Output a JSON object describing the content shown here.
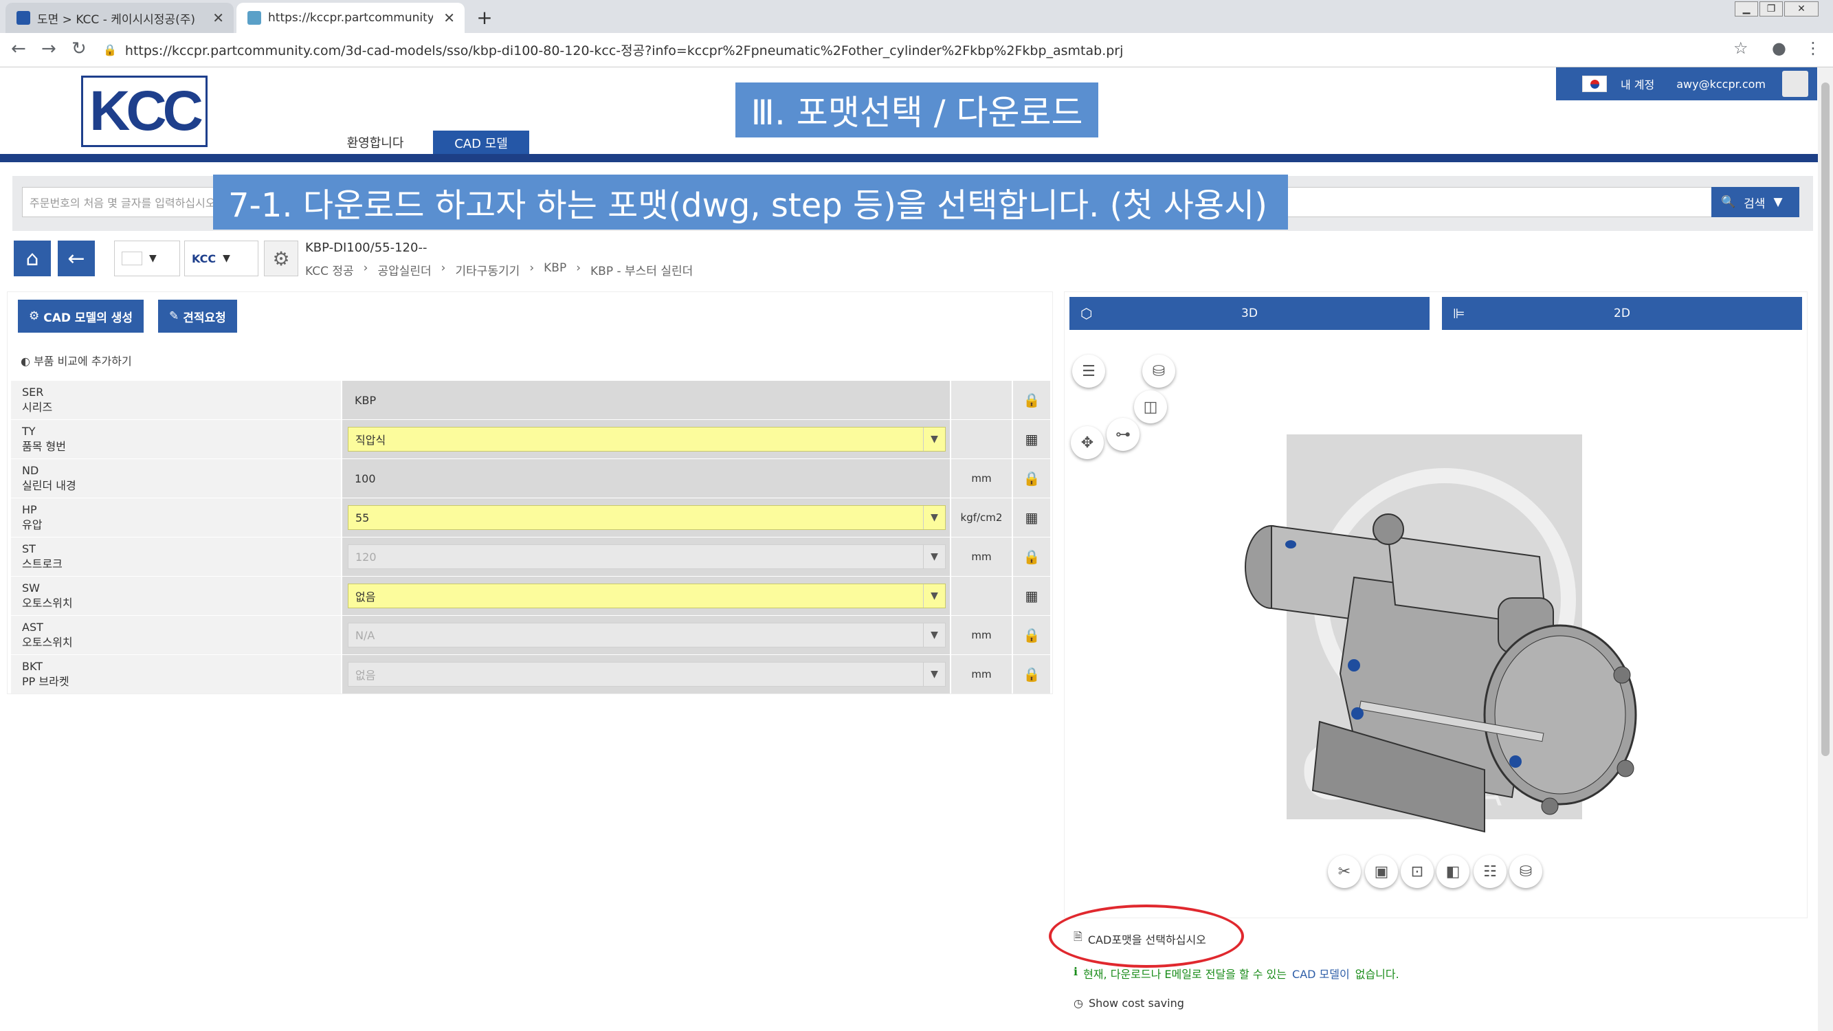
{
  "browser": {
    "tabs": [
      {
        "label": "도면 > KCC - 케이시시정공(주)",
        "active": false
      },
      {
        "label": "https://kccpr.partcommunity.cor",
        "active": true
      }
    ],
    "url": "https://kccpr.partcommunity.com/3d-cad-models/sso/kbp-di100-80-120-kcc-정공?info=kccpr%2Fpneumatic%2Fother_cylinder%2Fkbp%2Fkbp_asmtab.prj"
  },
  "header": {
    "logo": "KCC",
    "nav": {
      "welcome": "환영합니다",
      "cad": "CAD 모델"
    },
    "account": {
      "label": "내 계정",
      "email": "awy@kccpr.com"
    }
  },
  "overlays": {
    "title": "Ⅲ. 포맷선택 / 다운로드",
    "step": "7-1. 다운로드 하고자 하는 포맷(dwg, step 등)을 선택합니다. (첫 사용시)"
  },
  "search": {
    "placeholder": "주문번호의 처음 몇 글자를 입력하십시오",
    "button": "검색"
  },
  "product": {
    "name": "KBP-DI100/55-120--",
    "breadcrumb": [
      "KCC 정공",
      "공압실린더",
      "기타구동기기",
      "KBP",
      "KBP - 부스터 실린더"
    ]
  },
  "actions": {
    "create": "CAD 모델의 생성",
    "quote": "견적요청",
    "compare": "부품 비교에 추가하기"
  },
  "params": [
    {
      "code": "SER",
      "name": "시리즈",
      "value": "KBP",
      "unit": "",
      "style": "plain",
      "action": "lock"
    },
    {
      "code": "TY",
      "name": "품목 형번",
      "value": "직압식",
      "unit": "",
      "style": "yellow",
      "action": "table"
    },
    {
      "code": "ND",
      "name": "실린더 내경",
      "value": "100",
      "unit": "mm",
      "style": "plain",
      "action": "lock"
    },
    {
      "code": "HP",
      "name": "유압",
      "value": "55",
      "unit": "kgf/cm2",
      "style": "yellow",
      "action": "table"
    },
    {
      "code": "ST",
      "name": "스트로크",
      "value": "120",
      "unit": "mm",
      "style": "disabled",
      "action": "lock"
    },
    {
      "code": "SW",
      "name": "오토스위치",
      "value": "없음",
      "unit": "",
      "style": "yellow",
      "action": "table"
    },
    {
      "code": "AST",
      "name": "오토스위치",
      "value": "N/A",
      "unit": "mm",
      "style": "disabled",
      "action": "lock"
    },
    {
      "code": "BKT",
      "name": "PP 브라켓",
      "value": "없음",
      "unit": "mm",
      "style": "disabled",
      "action": "lock"
    }
  ],
  "viewer": {
    "tab3d": "3D",
    "tab2d": "2D"
  },
  "bottom": {
    "cad_format": "CAD포맷을 선택하십시오",
    "notice_prefix": "현재, 다운로드나 E메일로 전달을 할 수 있는",
    "notice_hl": "CAD 모델이",
    "notice_suffix": "없습니다.",
    "cost_saving": "Show cost saving"
  },
  "colors": {
    "brand": "#2e5ea8",
    "overlay": "#5a8fd0",
    "highlight": "#e0282e"
  }
}
